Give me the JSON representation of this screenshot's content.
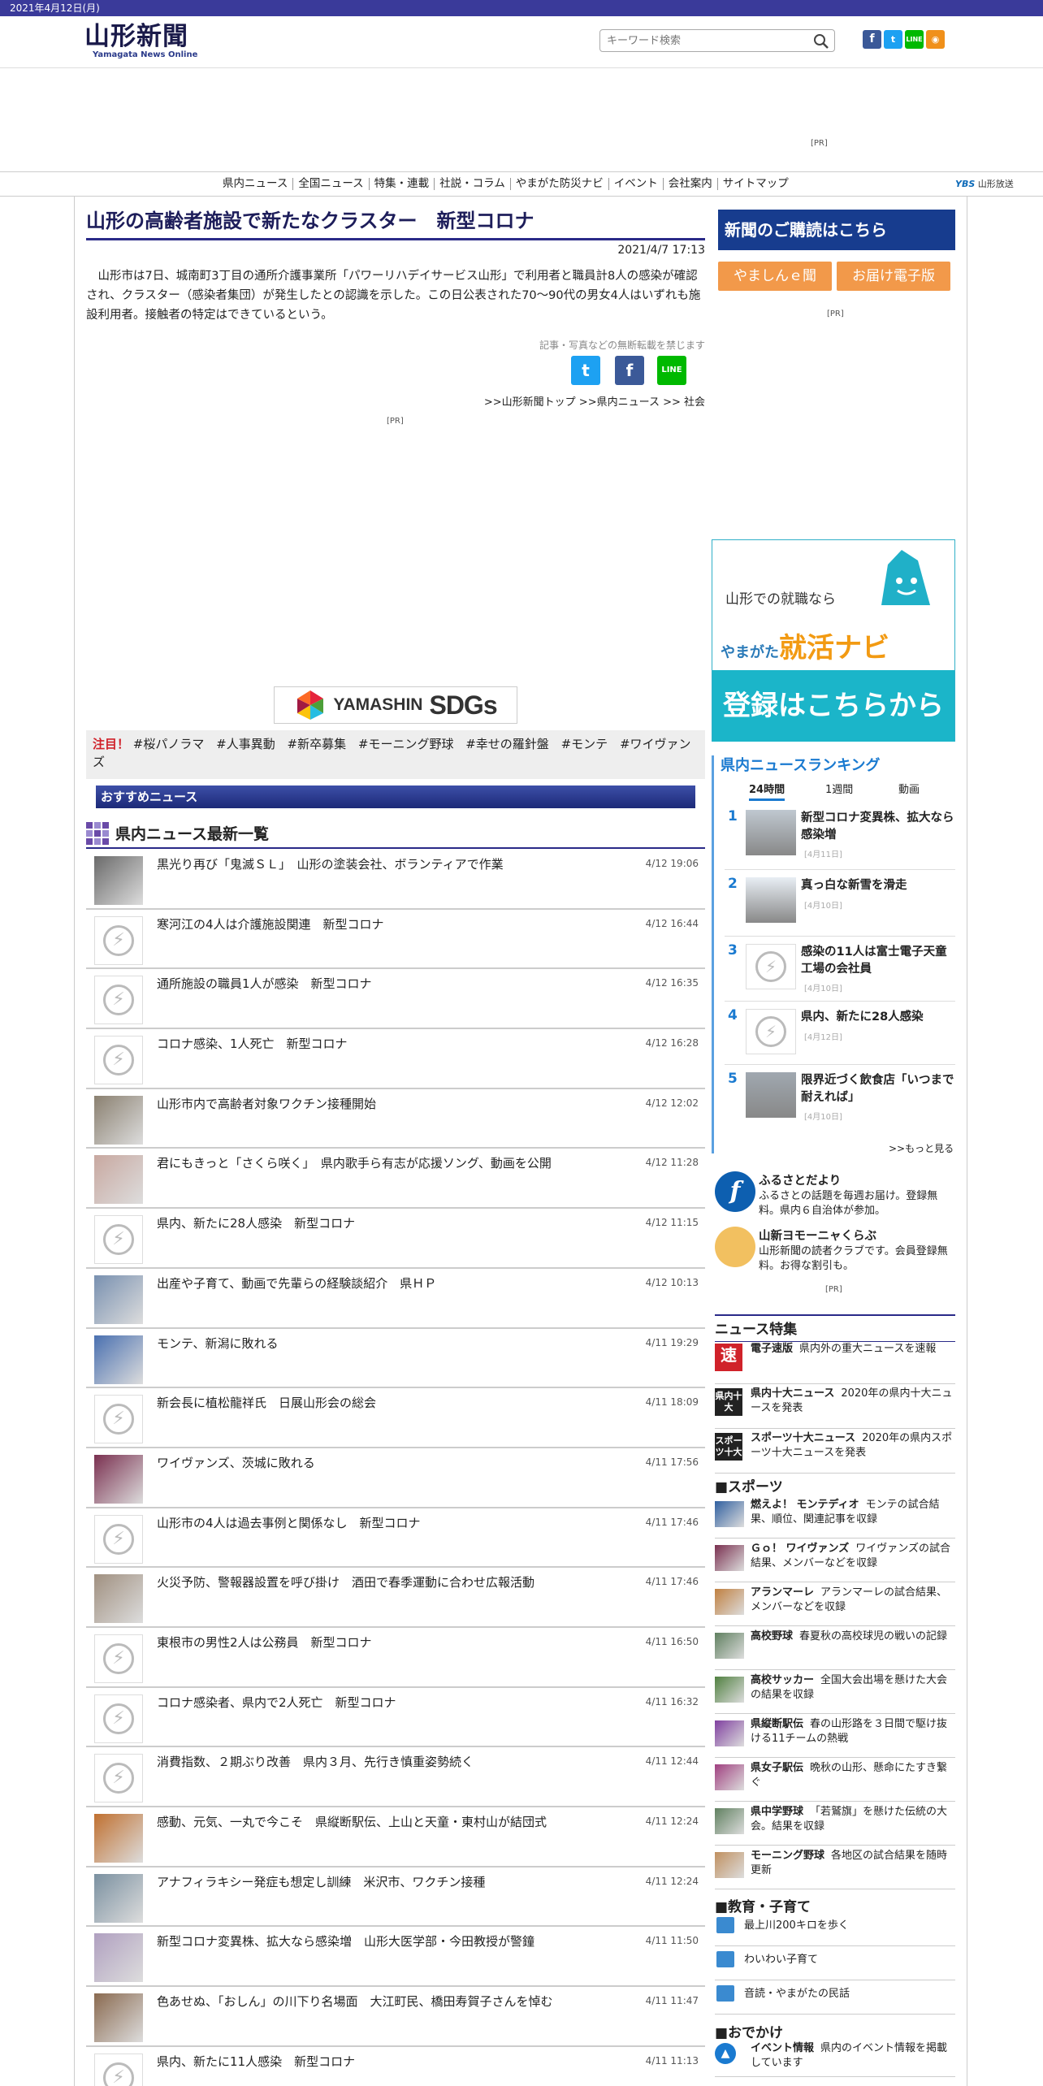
{
  "top_date": "2021年4月12日(月)",
  "logo": {
    "jp": "山形新聞",
    "en": "Yamagata News Online"
  },
  "search": {
    "placeholder": "キーワード検索"
  },
  "social": [
    "f",
    "t",
    "LINE",
    "rss"
  ],
  "header_pr": "[PR]",
  "nav": [
    "県内ニュース",
    "全国ニュース",
    "特集・連載",
    "社説・コラム",
    "やまがた防災ナビ",
    "イベント",
    "会社案内",
    "サイトマップ"
  ],
  "ybs": "山形放送",
  "article": {
    "title": "山形の高齢者施設で新たなクラスター　新型コロナ",
    "date": "2021/4/7 17:13",
    "body": "山形市は7日、城南町3丁目の通所介護事業所「パワーリハデイサービス山形」で利用者と職員計8人の感染が確認され、クラスター（感染者集団）が発生したとの認識を示した。この日公表された70～90代の男女4人はいずれも施設利用者。接触者の特定はできているという。",
    "notice": "記事・写真などの無断転載を禁じます",
    "breadcrumb": ">>山形新聞トップ >>県内ニュース >> 社会",
    "pr": "[PR]"
  },
  "sdgs": {
    "t1": "YAMASHIN",
    "t2": "SDGs"
  },
  "attention": {
    "label": "注目！",
    "tags": [
      "#桜パノラマ",
      "#人事異動",
      "#新卒募集",
      "#モーニング野球",
      "#幸せの羅針盤",
      "#モンテ",
      "#ワイヴァンズ"
    ]
  },
  "recommend": "おすすめニュース",
  "list_title": "県内ニュース最新一覧",
  "news": [
    {
      "title": "黒光り再び「鬼滅ＳＬ」　山形の塗装会社、ボランティアで作業",
      "time": "4/12 19:06",
      "img": "photo",
      "color": "#6a6a6a"
    },
    {
      "title": "寒河江の4人は介護施設関連　新型コロナ",
      "time": "4/12 16:44",
      "img": "placeholder"
    },
    {
      "title": "通所施設の職員1人が感染　新型コロナ",
      "time": "4/12 16:35",
      "img": "placeholder"
    },
    {
      "title": "コロナ感染、1人死亡　新型コロナ",
      "time": "4/12 16:28",
      "img": "placeholder"
    },
    {
      "title": "山形市内で高齢者対象ワクチン接種開始",
      "time": "4/12 12:02",
      "img": "photo",
      "color": "#8a8070"
    },
    {
      "title": "君にもきっと「さくら咲く」　県内歌手ら有志が応援ソング、動画を公開",
      "time": "4/12 11:28",
      "img": "photo",
      "color": "#c8a8a0"
    },
    {
      "title": "県内、新たに28人感染　新型コロナ",
      "time": "4/12 11:15",
      "img": "placeholder"
    },
    {
      "title": "出産や子育て、動画で先輩らの経験談紹介　県ＨＰ",
      "time": "4/12 10:13",
      "img": "photo",
      "color": "#7890b0"
    },
    {
      "title": "モンテ、新潟に敗れる",
      "time": "4/11 19:29",
      "img": "photo",
      "color": "#4a70b0"
    },
    {
      "title": "新会長に植松龍祥氏　日展山形会の総会",
      "time": "4/11 18:09",
      "img": "placeholder"
    },
    {
      "title": "ワイヴァンズ、茨城に敗れる",
      "time": "4/11 17:56",
      "img": "photo",
      "color": "#7a3050"
    },
    {
      "title": "山形市の4人は過去事例と関係なし　新型コロナ",
      "time": "4/11 17:46",
      "img": "placeholder"
    },
    {
      "title": "火災予防、警報器設置を呼び掛け　酒田で春季運動に合わせ広報活動",
      "time": "4/11 17:46",
      "img": "photo",
      "color": "#a09080"
    },
    {
      "title": "東根市の男性2人は公務員　新型コロナ",
      "time": "4/11 16:50",
      "img": "placeholder"
    },
    {
      "title": "コロナ感染者、県内で2人死亡　新型コロナ",
      "time": "4/11 16:32",
      "img": "placeholder"
    },
    {
      "title": "消費指数、２期ぶり改善　県内３月、先行き慎重姿勢続く",
      "time": "4/11 12:44",
      "img": "placeholder"
    },
    {
      "title": "感動、元気、一丸で今こそ　県縦断駅伝、上山と天童・東村山が結団式",
      "time": "4/11 12:24",
      "img": "photo",
      "color": "#c07030"
    },
    {
      "title": "アナフィラキシー発症も想定し訓練　米沢市、ワクチン接種",
      "time": "4/11 12:24",
      "img": "photo",
      "color": "#7a90a0"
    },
    {
      "title": "新型コロナ変異株、拡大なら感染増　山形大医学部・今田教授が警鐘",
      "time": "4/11 11:50",
      "img": "photo",
      "color": "#b0a0c0"
    },
    {
      "title": "色あせぬ、「おしん」の川下り名場面　大江町民、橋田寿賀子さんを悼む",
      "time": "4/11 11:47",
      "img": "photo",
      "color": "#8a6a50"
    },
    {
      "title": "県内、新たに11人感染　新型コロナ",
      "time": "4/11 11:13",
      "img": "placeholder"
    }
  ],
  "sidebar": {
    "subscribe": "新聞のご購読はこちら",
    "btn1": "やましんｅ聞",
    "btn2": "お届け電子版",
    "pr": "[PR]",
    "job_ad": {
      "t1": "山形での就職なら",
      "t2a": "やまがた",
      "t2b": "就活ナビ",
      "t3": "登録はこちらから"
    },
    "ranking": {
      "title": "県内ニュースランキング",
      "tabs": [
        "24時間",
        "1週間",
        "動画"
      ],
      "items": [
        {
          "rank": "1",
          "title": "新型コロナ変異株、拡大なら感染増",
          "date": "[4月11日]",
          "img": "photo"
        },
        {
          "rank": "2",
          "title": "真っ白な新雪を滑走",
          "date": "[4月10日]",
          "img": "photo"
        },
        {
          "rank": "3",
          "title": "感染の11人は富士電子天童工場の会社員",
          "date": "[4月10日]",
          "img": "placeholder"
        },
        {
          "rank": "4",
          "title": "県内、新たに28人感染",
          "date": "[4月12日]",
          "img": "placeholder"
        },
        {
          "rank": "5",
          "title": "限界近づく飲食店「いつまで耐えれば」",
          "date": "[4月10日]",
          "img": "photo"
        }
      ],
      "more": ">>もっと見る"
    },
    "furusato": {
      "title": "ふるさとだより",
      "desc": "ふるさとの話題を毎週お届け。登録無料。県内６自治体が参加。"
    },
    "club": {
      "title": "山新ヨモーニャくらぶ",
      "desc": "山形新聞の読者クラブです。会員登録無料。お得な割引も。"
    },
    "pr2": "[PR]",
    "features_title": "ニュース特集",
    "features": [
      {
        "icon": "速",
        "name": "電子速版",
        "desc": "県内外の重大ニュースを速報"
      },
      {
        "icon": "県内十大",
        "name": "県内十大ニュース",
        "desc": "2020年の県内十大ニュースを発表"
      },
      {
        "icon": "スポーツ十大",
        "name": "スポーツ十大ニュース",
        "desc": "2020年の県内スポーツ十大ニュースを発表"
      }
    ],
    "sports_title": "■スポーツ",
    "sports": [
      {
        "name": "燃えよ！ モンテディオ",
        "desc": "モンテの試合結果、順位、関連記事を収録",
        "color": "#3060a0"
      },
      {
        "name": "Ｇｏ！ ワイヴァンズ",
        "desc": "ワイヴァンズの試合結果、メンバーなどを収録",
        "color": "#7a3050"
      },
      {
        "name": "アランマーレ",
        "desc": "アランマーレの試合結果、メンバーなどを収録",
        "color": "#c08040"
      },
      {
        "name": "高校野球",
        "desc": "春夏秋の高校球児の戦いの記録",
        "color": "#608060"
      },
      {
        "name": "高校サッカー",
        "desc": "全国大会出場を懸けた大会の結果を収録",
        "color": "#508040"
      },
      {
        "name": "県縦断駅伝",
        "desc": "春の山形路を３日間で駆け抜ける11チームの熱戦",
        "color": "#8040a0"
      },
      {
        "name": "県女子駅伝",
        "desc": "晩秋の山形、懸命にたすき繋ぐ",
        "color": "#a04080"
      },
      {
        "name": "県中学野球",
        "desc": "「若鷲旗」を懸けた伝統の大会。結果を収録",
        "color": "#608060"
      },
      {
        "name": "モーニング野球",
        "desc": "各地区の試合結果を随時更新",
        "color": "#c09060"
      }
    ],
    "edu_title": "■教育・子育て",
    "edu": [
      "最上川200キロを歩く",
      "わいわい子育て",
      "音読・やまがたの民話"
    ],
    "out_title": "■おでかけ",
    "out": {
      "name": "イベント情報",
      "desc": "県内のイベント情報を掲載しています"
    }
  }
}
